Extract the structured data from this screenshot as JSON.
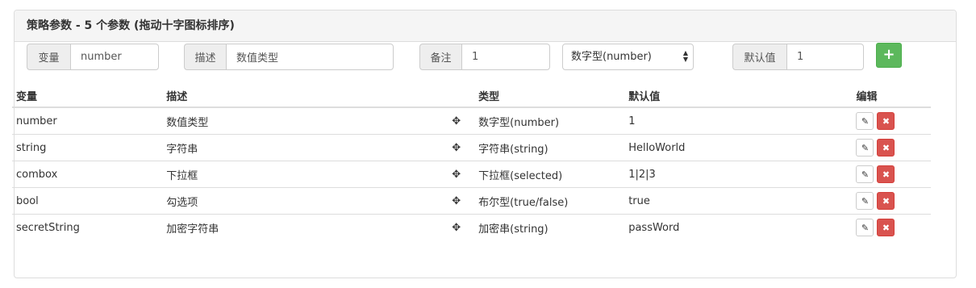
{
  "panel": {
    "title": "策略参数 - 5 个参数 (拖动十字图标排序)"
  },
  "form": {
    "variable_label": "变量",
    "variable_value": "number",
    "description_label": "描述",
    "description_value": "数值类型",
    "remark_label": "备注",
    "remark_value": "1",
    "type_selected": "数字型(number)",
    "default_label": "默认值",
    "default_value": "1",
    "add_button": "+"
  },
  "table": {
    "headers": [
      "变量",
      "描述",
      "类型",
      "默认值",
      "编辑"
    ],
    "rows": [
      {
        "variable": "number",
        "description": "数值类型",
        "type": "数字型(number)",
        "default": "1"
      },
      {
        "variable": "string",
        "description": "字符串",
        "type": "字符串(string)",
        "default": "HelloWorld"
      },
      {
        "variable": "combox",
        "description": "下拉框",
        "type": "下拉框(selected)",
        "default": "1|2|3"
      },
      {
        "variable": "bool",
        "description": "勾选项",
        "type": "布尔型(true/false)",
        "default": "true"
      },
      {
        "variable": "secretString",
        "description": "加密字符串",
        "type": "加密串(string)",
        "default": "passWord"
      }
    ]
  },
  "icons": {
    "move": "✥",
    "edit": "✎",
    "delete": "✖",
    "select_arrows": "▲▼"
  },
  "colors": {
    "add_button": "#5cb85c",
    "delete_button": "#d9534f",
    "heading_bg": "#f5f5f5"
  }
}
